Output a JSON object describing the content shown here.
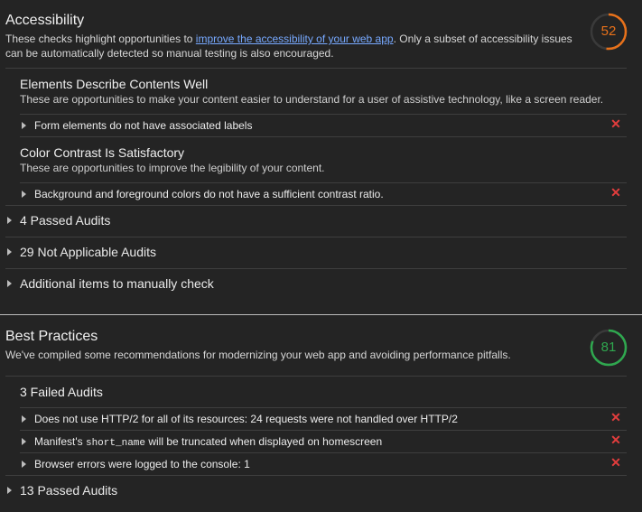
{
  "accessibility": {
    "title": "Accessibility",
    "desc_before": "These checks highlight opportunities to ",
    "desc_link": "improve the accessibility of your web app",
    "desc_after": ". Only a subset of accessibility issues can be automatically detected so manual testing is also encouraged.",
    "score": "52",
    "score_fraction": 0.52,
    "score_color": "#e8711a",
    "groups": [
      {
        "title": "Elements Describe Contents Well",
        "desc": "These are opportunities to make your content easier to understand for a user of assistive technology, like a screen reader.",
        "audits": [
          "Form elements do not have associated labels"
        ]
      },
      {
        "title": "Color Contrast Is Satisfactory",
        "desc": "These are opportunities to improve the legibility of your content.",
        "audits": [
          "Background and foreground colors do not have a sufficient contrast ratio."
        ]
      }
    ],
    "clumps": [
      "4 Passed Audits",
      "29 Not Applicable Audits",
      "Additional items to manually check"
    ]
  },
  "best_practices": {
    "title": "Best Practices",
    "desc": "We've compiled some recommendations for modernizing your web app and avoiding performance pitfalls.",
    "score": "81",
    "score_fraction": 0.81,
    "score_color": "#2fa84f",
    "failed_title": "3 Failed Audits",
    "audits": [
      {
        "text": "Does not use HTTP/2 for all of its resources: 24 requests were not handled over HTTP/2"
      },
      {
        "before": "Manifest's ",
        "code": "short_name",
        "after": " will be truncated when displayed on homescreen"
      },
      {
        "text": "Browser errors were logged to the console: 1"
      }
    ],
    "passed": "13 Passed Audits"
  },
  "icons": {
    "fail": "✕",
    "expand": "triangle-right"
  },
  "colors": {
    "background": "#242424",
    "link": "#77a9ff",
    "fail": "#e33d3d"
  }
}
